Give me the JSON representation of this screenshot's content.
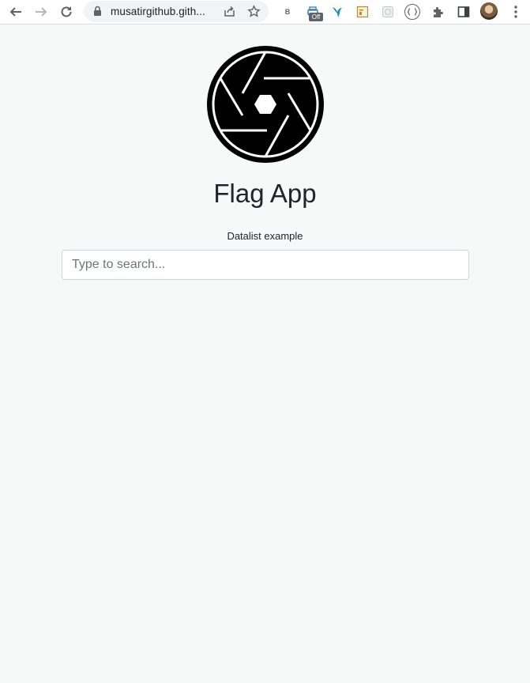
{
  "browser": {
    "url": "musatirgithub.gith...",
    "extension_badge": "Off",
    "extension_letter": "B"
  },
  "page": {
    "title": "Flag App",
    "datalist_label": "Datalist example",
    "search": {
      "placeholder": "Type to search...",
      "value": ""
    }
  },
  "icons": {
    "logo": "camera-aperture-icon"
  }
}
